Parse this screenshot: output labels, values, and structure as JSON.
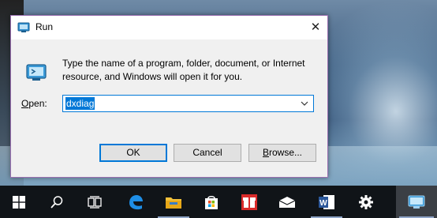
{
  "dialog": {
    "title": "Run",
    "close_glyph": "✕",
    "description": "Type the name of a program, folder, document, or Internet resource, and Windows will open it for you.",
    "open_label_prefix": "",
    "open_label_access_key": "O",
    "open_label_suffix": "pen:",
    "open_value": "dxdiag",
    "buttons": {
      "ok": "OK",
      "cancel": "Cancel",
      "browse_prefix": "",
      "browse_access_key": "B",
      "browse_suffix": "rowse..."
    }
  },
  "taskbar": {
    "items": [
      {
        "icon": "windows-start-icon"
      },
      {
        "icon": "search-icon"
      },
      {
        "icon": "task-view-icon"
      },
      {
        "icon": "edge-browser-icon"
      },
      {
        "icon": "file-explorer-icon"
      },
      {
        "icon": "store-icon"
      },
      {
        "icon": "gift-icon"
      },
      {
        "icon": "mail-icon"
      },
      {
        "icon": "word-icon",
        "label": "W"
      },
      {
        "icon": "settings-gear-icon"
      },
      {
        "icon": "run-app-icon"
      }
    ]
  },
  "colors": {
    "accent": "#0078d7",
    "dialog_border": "#9a6fb0",
    "taskbar": "#101418"
  }
}
